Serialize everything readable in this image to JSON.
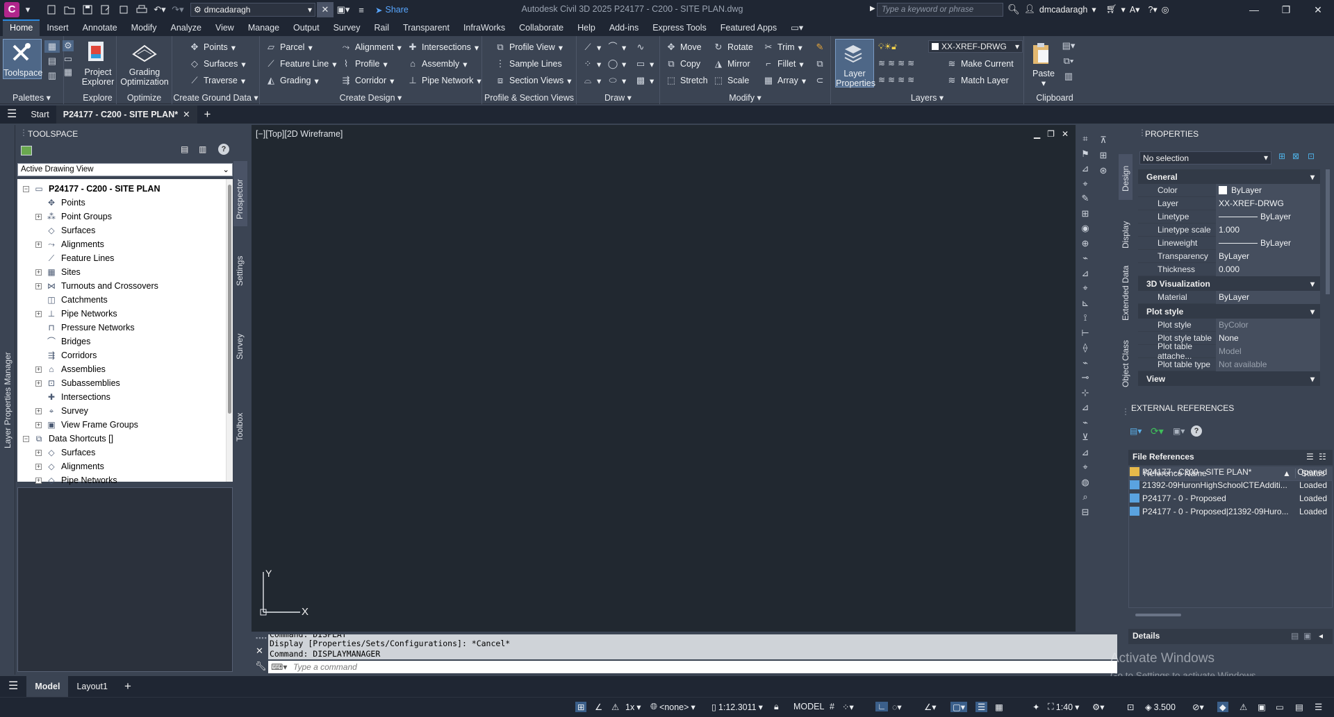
{
  "app": {
    "title": "Autodesk Civil 3D 2025   P24177 - C200 - SITE PLAN.dwg",
    "workspace": "dmcadaragh",
    "share_label": "Share",
    "search_placeholder": "Type a keyword or phrase",
    "user": "dmcadaragh"
  },
  "ribbon_tabs": [
    "Home",
    "Insert",
    "Annotate",
    "Modify",
    "Analyze",
    "View",
    "Manage",
    "Output",
    "Survey",
    "Rail",
    "Transparent",
    "InfraWorks",
    "Collaborate",
    "Help",
    "Add-ins",
    "Express Tools",
    "Featured Apps"
  ],
  "ribbon": {
    "palettes": {
      "toolspace": "Toolspace",
      "footer": "Palettes"
    },
    "explore": {
      "project_explorer": "Project Explorer",
      "footer": "Explore"
    },
    "optimize": {
      "grading_optimization": "Grading Optimization",
      "footer": "Optimize"
    },
    "ground": {
      "points": "Points",
      "surfaces": "Surfaces",
      "traverse": "Traverse",
      "footer": "Create Ground Data"
    },
    "design": {
      "parcel": "Parcel",
      "feature_line": "Feature Line",
      "grading": "Grading",
      "alignment": "Alignment",
      "profile": "Profile",
      "corridor": "Corridor",
      "intersections": "Intersections",
      "assembly": "Assembly",
      "pipe_network": "Pipe Network",
      "footer": "Create Design"
    },
    "profile_section": {
      "profile_view": "Profile View",
      "sample_lines": "Sample Lines",
      "section_views": "Section Views",
      "footer": "Profile & Section Views"
    },
    "draw": {
      "footer": "Draw"
    },
    "modify": {
      "move": "Move",
      "copy": "Copy",
      "stretch": "Stretch",
      "rotate": "Rotate",
      "mirror": "Mirror",
      "scale": "Scale",
      "trim": "Trim",
      "fillet": "Fillet",
      "array": "Array",
      "footer": "Modify"
    },
    "layers": {
      "layer_properties": "Layer Properties",
      "current_layer": "XX-XREF-DRWG",
      "make_current": "Make Current",
      "match_layer": "Match Layer",
      "footer": "Layers"
    },
    "clipboard": {
      "paste": "Paste",
      "footer": "Clipboard"
    }
  },
  "file_tabs": {
    "start": "Start",
    "active": "P24177 - C200 - SITE PLAN*"
  },
  "toolspace": {
    "header": "TOOLSPACE",
    "view_select": "Active Drawing View",
    "side_tabs": [
      "Prospector",
      "Settings",
      "Survey",
      "Toolbox"
    ],
    "left_strip": "Layer Properties Manager",
    "root": "P24177 - C200 - SITE PLAN",
    "items": [
      {
        "label": "Points",
        "exp": false
      },
      {
        "label": "Point Groups",
        "exp": true
      },
      {
        "label": "Surfaces",
        "exp": false
      },
      {
        "label": "Alignments",
        "exp": true
      },
      {
        "label": "Feature Lines",
        "exp": false
      },
      {
        "label": "Sites",
        "exp": true
      },
      {
        "label": "Turnouts and Crossovers",
        "exp": true
      },
      {
        "label": "Catchments",
        "exp": false
      },
      {
        "label": "Pipe Networks",
        "exp": true
      },
      {
        "label": "Pressure Networks",
        "exp": false
      },
      {
        "label": "Bridges",
        "exp": false
      },
      {
        "label": "Corridors",
        "exp": false
      },
      {
        "label": "Assemblies",
        "exp": true
      },
      {
        "label": "Subassemblies",
        "exp": true
      },
      {
        "label": "Intersections",
        "exp": false
      },
      {
        "label": "Survey",
        "exp": true
      },
      {
        "label": "View Frame Groups",
        "exp": true
      }
    ],
    "shortcuts_root": "Data Shortcuts []",
    "shortcut_items": [
      "Surfaces",
      "Alignments",
      "Pipe Networks"
    ]
  },
  "viewport": {
    "label": "[−][Top][2D Wireframe]",
    "ucs_x": "X",
    "ucs_y": "Y"
  },
  "command": {
    "history": [
      "Command: DISPLAY",
      "Display [Properties/Sets/Configurations]: *Cancel*",
      "Command: DISPLAYMANAGER"
    ],
    "placeholder": "Type a command"
  },
  "properties": {
    "header": "PROPERTIES",
    "selection": "No selection",
    "side_tabs": [
      "Design",
      "Display",
      "Extended Data",
      "Object Class"
    ],
    "sections": {
      "general": "General",
      "viz": "3D Visualization",
      "plot": "Plot style",
      "view": "View"
    },
    "general": [
      {
        "k": "Color",
        "v": "ByLayer"
      },
      {
        "k": "Layer",
        "v": "XX-XREF-DRWG"
      },
      {
        "k": "Linetype",
        "v": "ByLayer"
      },
      {
        "k": "Linetype scale",
        "v": "1.000"
      },
      {
        "k": "Lineweight",
        "v": "ByLayer"
      },
      {
        "k": "Transparency",
        "v": "ByLayer"
      },
      {
        "k": "Thickness",
        "v": "0.000"
      }
    ],
    "viz": [
      {
        "k": "Material",
        "v": "ByLayer"
      }
    ],
    "plot": [
      {
        "k": "Plot style",
        "v": "ByColor",
        "dim": true
      },
      {
        "k": "Plot style table",
        "v": "None",
        "dim": false
      },
      {
        "k": "Plot table attache...",
        "v": "Model",
        "dim": true
      },
      {
        "k": "Plot table type",
        "v": "Not available",
        "dim": true
      }
    ]
  },
  "xrefs": {
    "header": "EXTERNAL REFERENCES",
    "file_references": "File References",
    "col_name": "Reference Name",
    "col_status": "Status",
    "rows": [
      {
        "name": "P24177 - C200 - SITE PLAN*",
        "status": "Opened"
      },
      {
        "name": "21392-09HuronHighSchoolCTEAdditi...",
        "status": "Loaded"
      },
      {
        "name": "P24177 - 0 - Proposed",
        "status": "Loaded"
      },
      {
        "name": "P24177 - 0 - Proposed|21392-09Huro...",
        "status": "Loaded"
      }
    ],
    "details": "Details"
  },
  "layout_tabs": [
    "Model",
    "Layout1"
  ],
  "status": {
    "snap": "1x",
    "ucs": "<none>",
    "scale": "1:12.3011",
    "model": "MODEL",
    "anno": "1:40",
    "value": "3.500"
  },
  "watermark": {
    "line1": "Activate Windows",
    "line2": "Go to Settings to activate Windows."
  }
}
